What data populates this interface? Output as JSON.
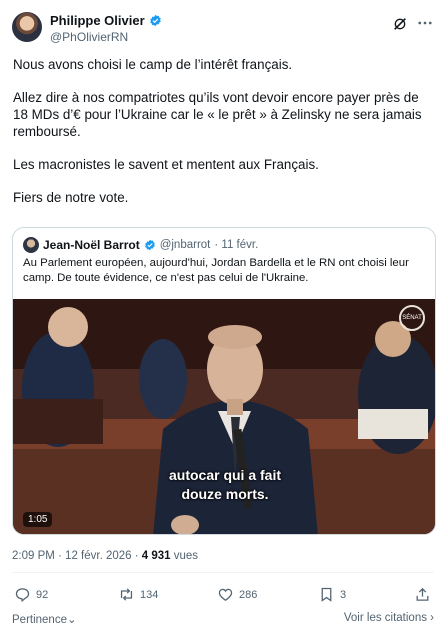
{
  "author": {
    "name": "Philippe Olivier",
    "handle": "@PhOlivierRN"
  },
  "tweet_paragraphs": [
    "Nous avons choisi le camp de l’intérêt français.",
    "Allez dire à nos compatriotes qu’ils vont devoir encore payer près de 18 MDs d’€ pour l’Ukraine car le « le prêt » à Zelinsky ne sera jamais remboursé.",
    "Les macronistes le savent et mentent aux Français.",
    "Fiers de notre vote."
  ],
  "quoted": {
    "name": "Jean-Noël Barrot",
    "handle": "@jnbarrot",
    "date": "· 11 févr.",
    "text": "Au Parlement européen, aujourd'hui, Jordan Bardella et le RN ont choisi leur camp. De toute évidence, ce n'est pas celui de l'Ukraine.",
    "video": {
      "subtitle_line1": "autocar qui a fait",
      "subtitle_line2": "douze morts.",
      "duration": "1:05",
      "logo_text": "SÉNAT"
    }
  },
  "meta": {
    "timestamp": "2:09 PM · 12 févr. 2026 · ",
    "views_count": "4 931",
    "views_label": " vues"
  },
  "actions": {
    "replies": "92",
    "reposts": "134",
    "likes": "286",
    "bookmarks": "3"
  },
  "footer": {
    "sort_label": "Pertinence",
    "quotes_link": "Voir les citations ›"
  },
  "colors": {
    "verified": "#1d9bf0",
    "secondary_text": "#536471",
    "border": "#cfd9de"
  },
  "icons": [
    "verified-icon",
    "grok-icon",
    "more-icon",
    "reply-icon",
    "repost-icon",
    "like-icon",
    "bookmark-icon",
    "chevron-down-icon"
  ]
}
